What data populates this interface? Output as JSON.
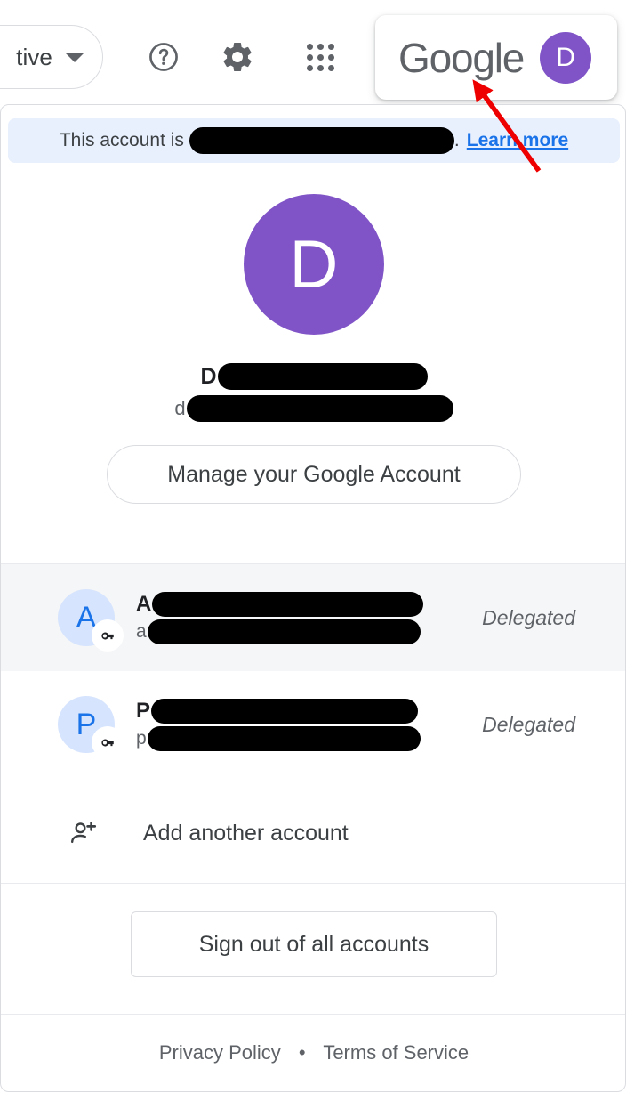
{
  "topbar": {
    "status_pill": {
      "label": "tive",
      "caret_icon": "chevron-down-icon"
    },
    "help_icon": "help-circle-icon",
    "settings_icon": "gear-icon",
    "apps_icon": "apps-grid-icon",
    "brand_wordmark": "Google",
    "avatar_initial": "D",
    "avatar_color": "#8054c7"
  },
  "banner": {
    "text_before": "This account is",
    "redacted": true,
    "text_after": ".",
    "learn_more": "Learn more",
    "background": "#e8f0fe",
    "link_color": "#1a73e8"
  },
  "profile": {
    "avatar_initial": "D",
    "avatar_color": "#8054c7",
    "name_prefix": "D",
    "name_redacted": true,
    "email_prefix": "d",
    "email_redacted": true,
    "manage_button": "Manage your Google Account"
  },
  "accounts": [
    {
      "initial": "A",
      "name_prefix": "A",
      "name_redacted": true,
      "email_prefix": "a",
      "email_redacted": true,
      "status": "Delegated",
      "badge_icon": "key-icon",
      "highlighted": true
    },
    {
      "initial": "P",
      "name_prefix": "P",
      "name_redacted": true,
      "email_prefix": "p",
      "email_redacted": true,
      "status": "Delegated",
      "badge_icon": "key-icon",
      "highlighted": false
    }
  ],
  "add_account": {
    "label": "Add another account",
    "icon": "person-add-icon"
  },
  "signout": {
    "label": "Sign out of all accounts"
  },
  "footer": {
    "privacy_label": "Privacy Policy",
    "separator": "•",
    "terms_label": "Terms of Service"
  },
  "annotation": {
    "arrow_color": "#ee0000",
    "points_to": "brand-wordmark"
  }
}
